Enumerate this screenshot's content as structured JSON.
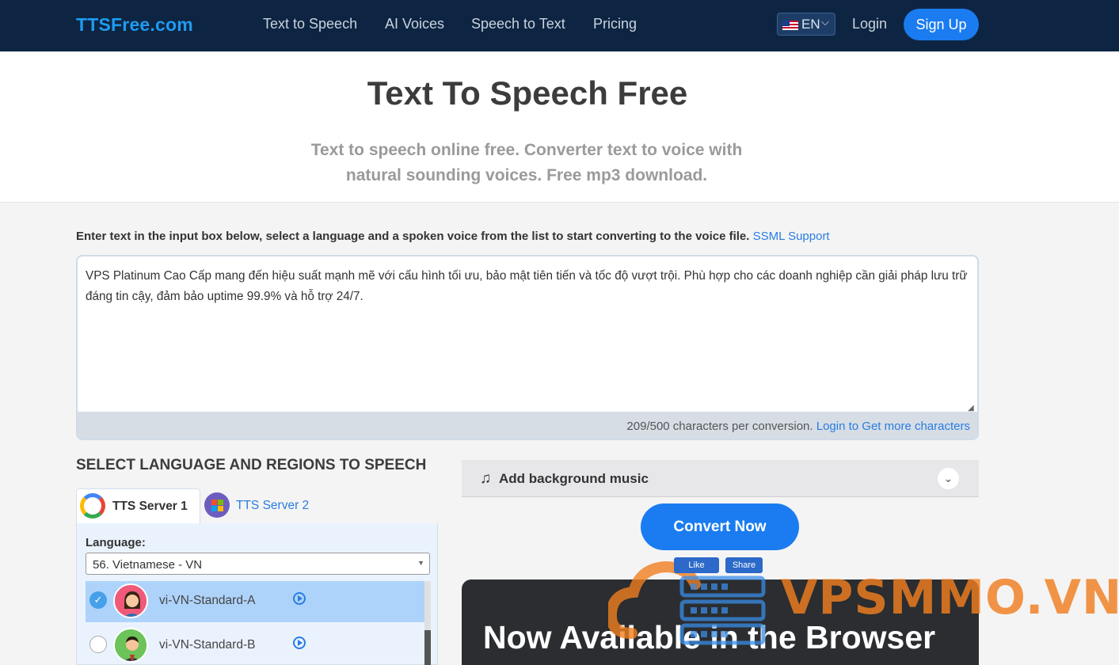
{
  "nav": {
    "logo": "TTSFree.com",
    "links": [
      "Text to Speech",
      "AI Voices",
      "Speech to Text",
      "Pricing"
    ],
    "language": "EN",
    "login": "Login",
    "signup": "Sign Up"
  },
  "hero": {
    "title": "Text To Speech Free",
    "subtitle": "Text to speech online free. Converter text to voice with natural sounding voices. Free mp3 download."
  },
  "instructions": {
    "text": "Enter text in the input box below, select a language and a spoken voice from the list to start converting to the voice file.",
    "ssml_link": "SSML Support"
  },
  "editor": {
    "value": "VPS Platinum Cao Cấp mang đến hiệu suất mạnh mẽ với cấu hình tối ưu, bảo mật tiên tiến và tốc độ vượt trội. Phù hợp cho các doanh nghiệp cần giải pháp lưu trữ đáng tin cậy, đảm bảo uptime 99.9% và hỗ trợ 24/7.",
    "char_count": "209/500 characters per conversion.",
    "login_more": "Login to Get more characters"
  },
  "language_section": {
    "title": "SELECT LANGUAGE AND REGIONS TO SPEECH",
    "tabs": [
      {
        "label": "TTS Server 1",
        "icon": "google-icon",
        "active": true
      },
      {
        "label": "TTS Server 2",
        "icon": "microsoft-icon",
        "active": false
      }
    ],
    "language_label": "Language:",
    "language_value": "56. Vietnamese - VN",
    "voices": [
      {
        "name": "vi-VN-Standard-A",
        "selected": true,
        "avatar": "female-avatar-icon"
      },
      {
        "name": "vi-VN-Standard-B",
        "selected": false,
        "avatar": "male-avatar-icon"
      }
    ]
  },
  "music": {
    "label": "Add background music"
  },
  "convert": {
    "label": "Convert Now"
  },
  "social": {
    "like": "Like",
    "share": "Share"
  },
  "banner": {
    "text": "Now Available in the Browser"
  },
  "watermark": {
    "text": "VPSMMO.VN"
  },
  "colors": {
    "nav_bg": "#0d2542",
    "accent": "#1a7cf0",
    "link": "#2a7de1",
    "watermark": "#f07e20"
  }
}
